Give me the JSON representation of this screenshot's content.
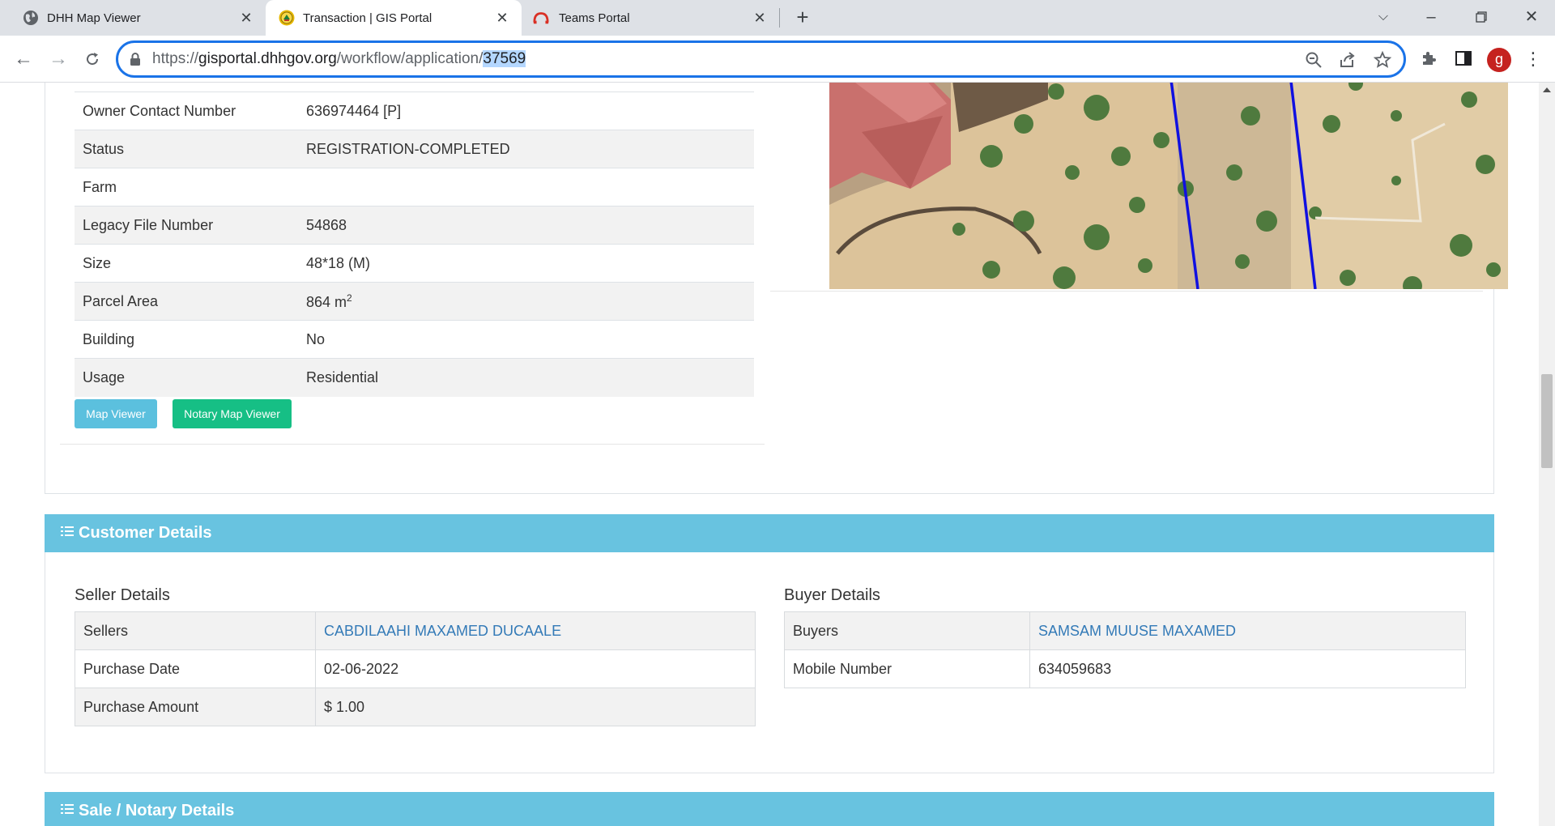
{
  "browser": {
    "tabs": [
      {
        "title": "DHH Map Viewer",
        "icon": "globe-icon",
        "active": false
      },
      {
        "title": "Transaction | GIS Portal",
        "icon": "emblem-icon",
        "active": true
      },
      {
        "title": "Teams Portal",
        "icon": "teams-portal-icon",
        "active": false
      }
    ],
    "new_tab_label": "+",
    "url": {
      "scheme": "https://",
      "host": "gisportal.dhhgov.org",
      "path": "/workflow/application/",
      "selected": "37569"
    },
    "profile_initial": "g",
    "accent_color": "#1a73e8"
  },
  "parcel": {
    "rows": [
      {
        "label": "Owner Contact Number",
        "value": "636974464 [P]"
      },
      {
        "label": "Status",
        "value": "REGISTRATION-COMPLETED"
      },
      {
        "label": "Farm",
        "value": ""
      },
      {
        "label": "Legacy File Number",
        "value": "54868"
      },
      {
        "label": "Size",
        "value": "48*18 (M)"
      },
      {
        "label": "Parcel Area",
        "value": "864 m",
        "sup": "2"
      },
      {
        "label": "Building",
        "value": "No"
      },
      {
        "label": "Usage",
        "value": "Residential"
      }
    ],
    "buttons": {
      "map_viewer": "Map Viewer",
      "notary_map_viewer": "Notary Map Viewer"
    }
  },
  "customer": {
    "heading": "Customer Details",
    "heading_color": "#68c3e0",
    "seller": {
      "title": "Seller Details",
      "rows": [
        {
          "label": "Sellers",
          "value": "CABDILAAHI MAXAMED DUCAALE",
          "link": true
        },
        {
          "label": "Purchase Date",
          "value": "02-06-2022"
        },
        {
          "label": "Purchase Amount",
          "value": "$ 1.00"
        }
      ]
    },
    "buyer": {
      "title": "Buyer Details",
      "rows": [
        {
          "label": "Buyers",
          "value": "SAMSAM MUUSE MAXAMED",
          "link": true
        },
        {
          "label": "Mobile Number",
          "value": "634059683"
        }
      ]
    }
  },
  "sale": {
    "heading": "Sale / Notary Details"
  }
}
